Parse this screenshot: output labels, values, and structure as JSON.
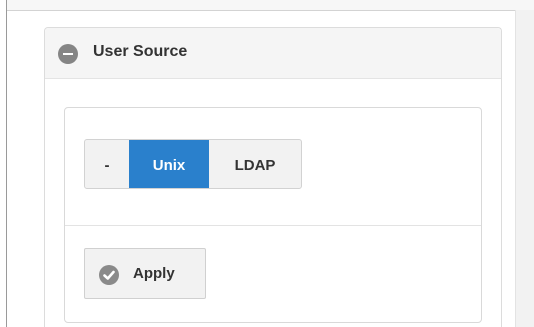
{
  "panel": {
    "title": "User Source",
    "collapse_icon": "minus-circle-icon"
  },
  "user_source": {
    "options": [
      {
        "label": "-",
        "selected": false
      },
      {
        "label": "Unix",
        "selected": true
      },
      {
        "label": "LDAP",
        "selected": false
      }
    ],
    "selected_color": "#2a80cc"
  },
  "apply_button": {
    "label": "Apply",
    "icon": "check-circle-icon"
  }
}
